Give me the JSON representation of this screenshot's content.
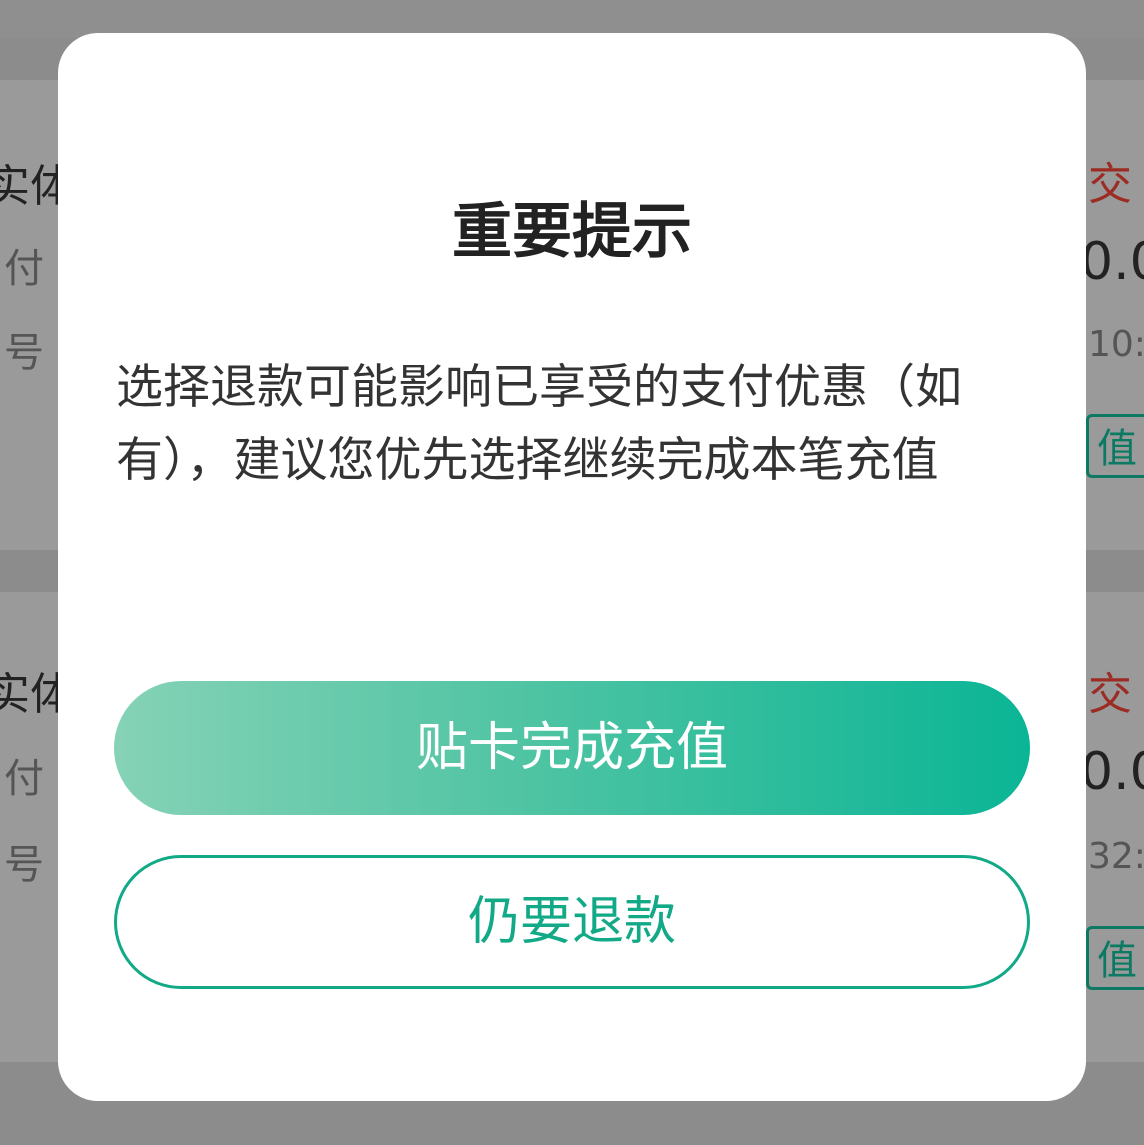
{
  "background_list": {
    "card1": {
      "name_fragment": "实体",
      "line2_fragment": "付",
      "line3_fragment": "号",
      "status_fragment": "交",
      "amount_fragment": "0.0",
      "time_fragment": "10:",
      "button_fragment": "值"
    },
    "card2": {
      "name_fragment": "实体",
      "line2_fragment": "付",
      "line3_fragment": "号",
      "status_fragment": "交",
      "amount_fragment": "0.0",
      "time_fragment": "32:",
      "button_fragment": "值"
    }
  },
  "dialog": {
    "title": "重要提示",
    "message": "选择退款可能影响已享受的支付优惠（如有），建议您优先选择继续完成本笔充值",
    "primary_button": "贴卡完成充值",
    "secondary_button": "仍要退款"
  },
  "colors": {
    "overlay": "#8f8f8f",
    "accent_green": "#12a987",
    "primary_gradient_start": "#86d2b6",
    "primary_gradient_end": "#0ab595",
    "status_red": "#9c2b23"
  }
}
